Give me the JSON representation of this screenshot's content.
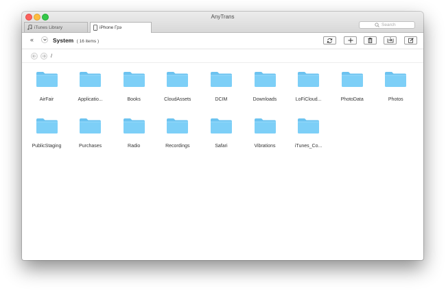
{
  "window": {
    "title": "AnyTrans",
    "tabs": [
      {
        "label": "iTunes Library",
        "icon": "music-note-icon",
        "active": false
      },
      {
        "label": "iPhone Грэ",
        "icon": "iphone-icon",
        "active": true
      }
    ],
    "search": {
      "placeholder": "Search",
      "value": ""
    }
  },
  "toolbar": {
    "folder_name": "System",
    "item_count": "( 16 items )",
    "actions": [
      {
        "name": "refresh",
        "icon": "refresh-icon"
      },
      {
        "name": "add",
        "icon": "plus-icon"
      },
      {
        "name": "delete",
        "icon": "trash-icon"
      },
      {
        "name": "export",
        "icon": "export-icon"
      },
      {
        "name": "edit",
        "icon": "edit-icon"
      }
    ]
  },
  "path": {
    "current": "/"
  },
  "folders": [
    {
      "name": "AirFair"
    },
    {
      "name": "Applicatio..."
    },
    {
      "name": "Books"
    },
    {
      "name": "CloudAssets"
    },
    {
      "name": "DCIM"
    },
    {
      "name": "Downloads"
    },
    {
      "name": "LoFiCloud..."
    },
    {
      "name": "PhotoData"
    },
    {
      "name": "Photos"
    },
    {
      "name": "PublicStaging"
    },
    {
      "name": "Purchases"
    },
    {
      "name": "Radio"
    },
    {
      "name": "Recordings"
    },
    {
      "name": "Safari"
    },
    {
      "name": "Vibrations"
    },
    {
      "name": "iTunes_Co..."
    }
  ],
  "colors": {
    "folder_body": "#7dcff7",
    "folder_tab": "#6cc3f0",
    "close": "#fc615d",
    "minimize": "#fdbc40",
    "zoom": "#34c84a"
  }
}
